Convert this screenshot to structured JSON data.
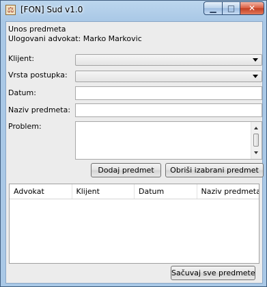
{
  "window": {
    "title": "[FON] Sud v1.0",
    "minimize_label": "▁",
    "maximize_label": "□",
    "close_label": "✕"
  },
  "form": {
    "header": "Unos predmeta",
    "logged_user": "Ulogovani advokat: Marko Markovic",
    "client_label": "Klijent:",
    "client_value": "",
    "procedure_label": "Vrsta postupka:",
    "procedure_value": "",
    "date_label": "Datum:",
    "date_value": "",
    "case_name_label": "Naziv predmeta:",
    "case_name_value": "",
    "problem_label": "Problem:",
    "problem_value": ""
  },
  "buttons": {
    "add": "Dodaj predmet",
    "delete": "Obriši izabrani predmet",
    "save_all": "Sačuvaj sve predmete"
  },
  "table": {
    "columns": [
      "Advokat",
      "Klijent",
      "Datum",
      "Naziv predmeta"
    ],
    "rows": []
  }
}
